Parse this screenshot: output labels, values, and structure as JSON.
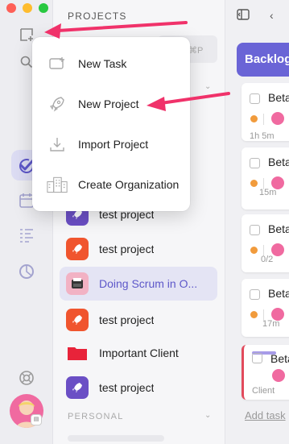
{
  "sidebar": {
    "section_title": "PROJECTS",
    "search_shortcut": "⌘P",
    "projects": [
      {
        "name": "test project",
        "icon": "rocket-icon",
        "color": "#6b4fc5"
      },
      {
        "name": "test project",
        "icon": "rocket-icon",
        "color": "#f0552e"
      },
      {
        "name": "Doing Scrum in O...",
        "icon": "typewriter-icon",
        "color": "#f2b2c4",
        "selected": true
      },
      {
        "name": "test project",
        "icon": "rocket-icon",
        "color": "#f0552e"
      },
      {
        "name": "Important Client",
        "icon": "folder-icon",
        "color": "#e8233a"
      },
      {
        "name": "test project",
        "icon": "rocket-icon",
        "color": "#6b4fc5"
      }
    ],
    "personal_label": "PERSONAL"
  },
  "popup_menu": {
    "items": [
      {
        "label": "New Task",
        "icon": "new-task-icon"
      },
      {
        "label": "New Project",
        "icon": "rocket-outline-icon"
      },
      {
        "label": "Import Project",
        "icon": "import-icon"
      },
      {
        "label": "Create Organization",
        "icon": "building-icon"
      }
    ]
  },
  "board": {
    "column_title": "Backlog",
    "cards": [
      {
        "title": "Beta",
        "meta": "1h 5m"
      },
      {
        "title": "Beta",
        "meta": "15m"
      },
      {
        "title": "Beta",
        "meta": "0/2"
      },
      {
        "title": "Beta",
        "meta": "17m"
      },
      {
        "title": "Beta",
        "meta": "Client"
      }
    ],
    "add_task_label": "Add task"
  },
  "colors": {
    "accent": "#6a64d6",
    "arrow": "#f0326a",
    "selected_text": "#5d57c9"
  }
}
